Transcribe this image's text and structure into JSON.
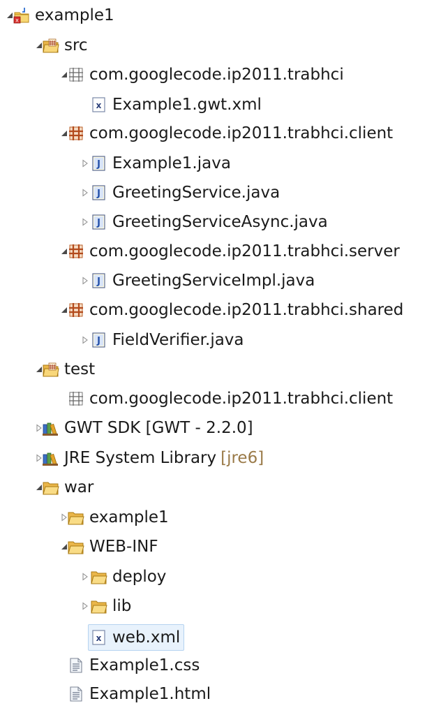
{
  "tree": {
    "items": [
      {
        "label": "example1",
        "icon": "gwt-project-icon",
        "expanded": true
      },
      {
        "label": "src",
        "icon": "source-folder-icon",
        "expanded": true
      },
      {
        "label": "com.googlecode.ip2011.trabhci",
        "icon": "package-empty-icon",
        "expanded": true
      },
      {
        "label": "Example1.gwt.xml",
        "icon": "xml-file-icon"
      },
      {
        "label": "com.googlecode.ip2011.trabhci.client",
        "icon": "package-icon",
        "expanded": true
      },
      {
        "label": "Example1.java",
        "icon": "java-file-icon",
        "expanded": false
      },
      {
        "label": "GreetingService.java",
        "icon": "java-file-icon",
        "expanded": false
      },
      {
        "label": "GreetingServiceAsync.java",
        "icon": "java-file-icon",
        "expanded": false
      },
      {
        "label": "com.googlecode.ip2011.trabhci.server",
        "icon": "package-icon",
        "expanded": true
      },
      {
        "label": "GreetingServiceImpl.java",
        "icon": "java-file-icon",
        "expanded": false
      },
      {
        "label": "com.googlecode.ip2011.trabhci.shared",
        "icon": "package-icon",
        "expanded": true
      },
      {
        "label": "FieldVerifier.java",
        "icon": "java-file-icon",
        "expanded": false
      },
      {
        "label": "test",
        "icon": "source-folder-icon",
        "expanded": true
      },
      {
        "label": "com.googlecode.ip2011.trabhci.client",
        "icon": "package-empty-icon"
      },
      {
        "label": "GWT SDK [GWT - 2.2.0]",
        "icon": "library-icon",
        "expanded": false
      },
      {
        "label": "JRE System Library",
        "decoration": "[jre6]",
        "icon": "library-icon",
        "expanded": false
      },
      {
        "label": "war",
        "icon": "folder-icon",
        "expanded": true
      },
      {
        "label": "example1",
        "icon": "folder-icon",
        "expanded": false
      },
      {
        "label": "WEB-INF",
        "icon": "folder-icon",
        "expanded": true
      },
      {
        "label": "deploy",
        "icon": "folder-icon",
        "expanded": false
      },
      {
        "label": "lib",
        "icon": "folder-icon",
        "expanded": false
      },
      {
        "label": "web.xml",
        "icon": "xml-file-icon",
        "selected": true
      },
      {
        "label": "Example1.css",
        "icon": "text-file-icon"
      },
      {
        "label": "Example1.html",
        "icon": "text-file-icon"
      }
    ]
  },
  "colors": {
    "selection_bg": "#e8f2fc",
    "selection_border": "#b5d3f0",
    "decoration_text": "#9a7a48",
    "text": "#1a1a1a"
  }
}
